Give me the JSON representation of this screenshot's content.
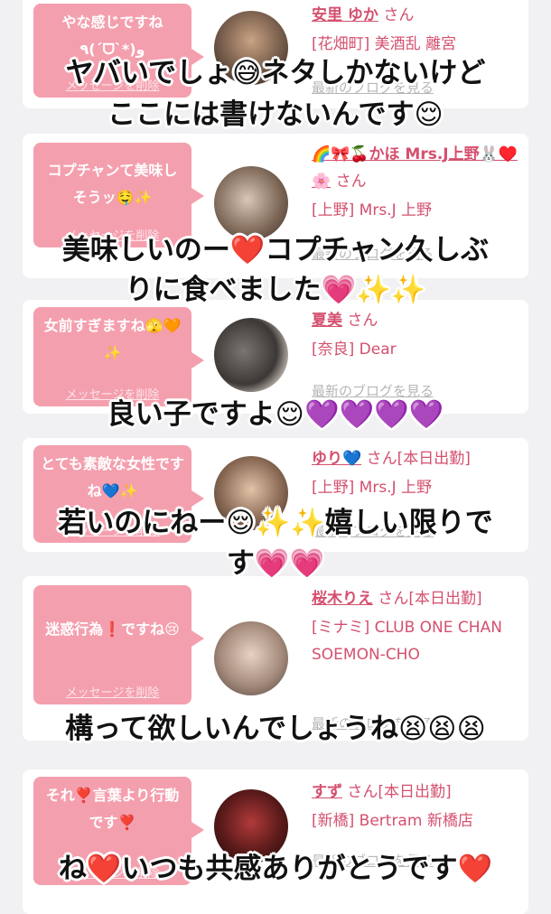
{
  "entries": [
    {
      "bubble": "やな感じですね ٩(ˊᗜˋ*)و",
      "delete": "メッセージを削除",
      "name": "安里 ゆか",
      "san": "さん",
      "shop": "[花畑町] 美酒乱 離宮",
      "blog": "最新のブログを見る"
    },
    {
      "bubble": "コプチャンて美味しそうッ🤤✨",
      "delete": "メッセージを削除",
      "name": "🌈🎀🍒かほ Mrs.J上野🐰♥️🌸",
      "san": "さん",
      "shop": "[上野] Mrs.J 上野",
      "blog": "最新のブログを見る"
    },
    {
      "bubble": "女前すぎますね🫣🧡✨",
      "delete": "メッセージを削除",
      "name": "夏美",
      "san": "さん",
      "shop": "[奈良] Dear",
      "blog": "最新のブログを見る"
    },
    {
      "bubble": "とても素敵な女性ですね💙✨",
      "delete": "メッセージを削除",
      "name": "ゆり💙",
      "san": "さん[本日出勤]",
      "shop": "[上野] Mrs.J 上野",
      "blog": "最新のブログを見る"
    },
    {
      "bubble": "迷惑行為❗️ですね😢",
      "delete": "メッセージを削除",
      "name": "桜木りえ",
      "san": "さん[本日出勤]",
      "shop": "[ミナミ] CLUB ONE CHAN SOEMON-CHO",
      "blog": "最新のブログを見る"
    },
    {
      "bubble": "それ❣️言葉より行動です❣️",
      "delete": "メッセージを削除",
      "name": "すず",
      "san": "さん[本日出勤]",
      "shop": "[新橋] Bertram 新橋店",
      "blog": "最新のブログを見る"
    }
  ],
  "captions": [
    "ヤバいでしょ😅ネタしかないけど",
    "ここには書けないんです😌",
    "美味しいのー❤️コプチャン久しぶ",
    "りに食べました💗✨✨",
    "良い子ですよ😌💜💜💜💜",
    "若いのにねー😌✨✨嬉しい限りで",
    "す💗💗",
    "構って欲しいんでしょうね😫😫😫",
    "ね❤️いつも共感ありがとうです❤️"
  ],
  "colors": {
    "bubble": "#f49fae",
    "accent": "#d4506e",
    "muted": "#b6b6b6",
    "background": "#f1f1f3"
  }
}
